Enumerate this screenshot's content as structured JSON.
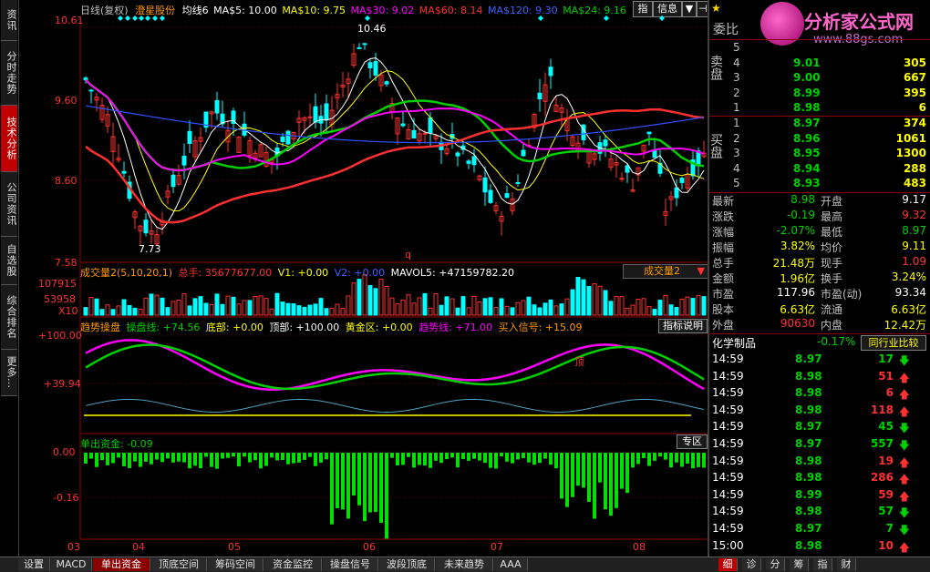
{
  "left_tabs": [
    {
      "label": "资讯",
      "active": false
    },
    {
      "label": "分时走势",
      "active": false
    },
    {
      "label": "技术分析",
      "active": true
    },
    {
      "label": "公司资讯",
      "active": false
    },
    {
      "label": "自选股",
      "active": false
    },
    {
      "label": "综合排名",
      "active": false
    },
    {
      "label": "更多…",
      "active": false
    }
  ],
  "main_header": {
    "period": "日线(复权)",
    "stock_name": "澄星股份",
    "ma_label": "均线6",
    "ma5": "MA$5: 10.00",
    "ma10": "MA$10: 9.75",
    "ma30": "MA$30: 9.02",
    "ma60": "MA$60: 8.14",
    "ma120": "MA$120: 9.30",
    "ma24": "MA$24: 9.16"
  },
  "top_buttons": {
    "zhi": "指",
    "info": "信息",
    "dropdown": "▼",
    "pin": "⊣"
  },
  "price_axis": [
    "10.61",
    "9.60",
    "8.60",
    "7.58"
  ],
  "price_annotations": {
    "high": "10.46",
    "low": "7.73",
    "q_mark": "q"
  },
  "volume_header": {
    "title": "成交量2(5,10,20,1)",
    "total": "总手: 35677677.00",
    "v1": "V1: +0.00",
    "v2": "V2: +0.00",
    "mavol5": "MAVOL5: +47159782.20",
    "selector": "成交量2"
  },
  "volume_axis": [
    "107915",
    "53958",
    "X10"
  ],
  "trend_header": {
    "title": "趋势操盘",
    "line": "操盘线: +74.56",
    "bottom": "底部: +0.00",
    "top": "顶部: +100.00",
    "gold": "黄金区: +0.00",
    "trend": "趋势线: +71.00",
    "buy": "买入信号: +15.09",
    "help": "指标说明"
  },
  "trend_axis": [
    "+100.00",
    "+39.94"
  ],
  "trend_top_mark": "顶",
  "flow_header": {
    "title": "单出资金: -0.09",
    "zone_button": "专区"
  },
  "flow_axis": [
    "0.00",
    "-0.16"
  ],
  "date_axis": [
    "03",
    "04",
    "05",
    "06",
    "07",
    "08"
  ],
  "right_panel": {
    "weibi_label": "委比",
    "sell_label": "卖盘",
    "buy_label": "买盘",
    "sells": [
      {
        "lvl": "5",
        "price": "",
        "vol": ""
      },
      {
        "lvl": "4",
        "price": "9.01",
        "vol": "305"
      },
      {
        "lvl": "3",
        "price": "9.00",
        "vol": "667"
      },
      {
        "lvl": "2",
        "price": "8.99",
        "vol": "395"
      },
      {
        "lvl": "1",
        "price": "8.98",
        "vol": "6"
      }
    ],
    "buys": [
      {
        "lvl": "1",
        "price": "8.97",
        "vol": "374"
      },
      {
        "lvl": "2",
        "price": "8.96",
        "vol": "1061"
      },
      {
        "lvl": "3",
        "price": "8.95",
        "vol": "1300"
      },
      {
        "lvl": "4",
        "price": "8.94",
        "vol": "288"
      },
      {
        "lvl": "5",
        "price": "8.93",
        "vol": "483"
      }
    ],
    "stats": [
      {
        "l1": "最新",
        "v1": "8.98",
        "c1": "#00d000",
        "l2": "开盘",
        "v2": "9.17",
        "c2": "#ffffff"
      },
      {
        "l1": "涨跌",
        "v1": "-0.19",
        "c1": "#00d000",
        "l2": "最高",
        "v2": "9.32",
        "c2": "#ff3030"
      },
      {
        "l1": "涨幅",
        "v1": "-2.07%",
        "c1": "#00d000",
        "l2": "最低",
        "v2": "8.97",
        "c2": "#00d000"
      },
      {
        "l1": "振幅",
        "v1": "3.82%",
        "c1": "#ffff00",
        "l2": "均价",
        "v2": "9.11",
        "c2": "#ffff00"
      },
      {
        "l1": "总手",
        "v1": "21.48万",
        "c1": "#ffff00",
        "l2": "现手",
        "v2": "1.09",
        "c2": "#ff3030"
      },
      {
        "l1": "金额",
        "v1": "1.96亿",
        "c1": "#ffff00",
        "l2": "换手",
        "v2": "3.24%",
        "c2": "#ffff00"
      },
      {
        "l1": "市盈",
        "v1": "117.96",
        "c1": "#ffffff",
        "l2": "市盈(动)",
        "v2": "93.34",
        "c2": "#ffffff"
      },
      {
        "l1": "股本",
        "v1": "6.63亿",
        "c1": "#ffff00",
        "l2": "流通",
        "v2": "6.63亿",
        "c2": "#ffff00"
      },
      {
        "l1": "外盘",
        "v1": "90630",
        "c1": "#ff3030",
        "l2": "内盘",
        "v2": "12.42万",
        "c2": "#ffff00"
      }
    ],
    "industry": {
      "name": "化学制品",
      "change": "-0.17%",
      "button": "同行业比较"
    },
    "ticks": [
      {
        "time": "14:59",
        "price": "8.97",
        "pc": "#00d000",
        "vol": "17",
        "vc": "#00d000",
        "dir": "down"
      },
      {
        "time": "14:59",
        "price": "8.98",
        "pc": "#00d000",
        "vol": "51",
        "vc": "#ff3030",
        "dir": "up"
      },
      {
        "time": "14:59",
        "price": "8.98",
        "pc": "#00d000",
        "vol": "6",
        "vc": "#ff3030",
        "dir": "up"
      },
      {
        "time": "14:59",
        "price": "8.98",
        "pc": "#00d000",
        "vol": "118",
        "vc": "#ff3030",
        "dir": "up"
      },
      {
        "time": "14:59",
        "price": "8.97",
        "pc": "#00d000",
        "vol": "45",
        "vc": "#00d000",
        "dir": "down"
      },
      {
        "time": "14:59",
        "price": "8.97",
        "pc": "#00d000",
        "vol": "557",
        "vc": "#00d000",
        "dir": "down"
      },
      {
        "time": "14:59",
        "price": "8.98",
        "pc": "#00d000",
        "vol": "19",
        "vc": "#ff3030",
        "dir": "up"
      },
      {
        "time": "14:59",
        "price": "8.98",
        "pc": "#00d000",
        "vol": "286",
        "vc": "#ff3030",
        "dir": "up"
      },
      {
        "time": "14:59",
        "price": "8.99",
        "pc": "#00d000",
        "vol": "59",
        "vc": "#ff3030",
        "dir": "up"
      },
      {
        "time": "14:59",
        "price": "8.98",
        "pc": "#00d000",
        "vol": "57",
        "vc": "#00d000",
        "dir": "down"
      },
      {
        "time": "14:59",
        "price": "8.97",
        "pc": "#00d000",
        "vol": "7",
        "vc": "#00d000",
        "dir": "down"
      },
      {
        "time": "15:00",
        "price": "8.98",
        "pc": "#00d000",
        "vol": "10",
        "vc": "#ff3030",
        "dir": "up"
      }
    ]
  },
  "logo": {
    "name": "分析家公式网",
    "url": "www.88gs.com"
  },
  "bottom_tabs": [
    "设置",
    "MACD",
    "单出资金",
    "顶底空间",
    "筹码空间",
    "资金监控",
    "操盘信号",
    "波段顶底",
    "未来趋势",
    "AAA"
  ],
  "bottom_active": "单出资金",
  "right_bottom_tabs": [
    "细",
    "诊",
    "分",
    "筹",
    "指",
    "财"
  ],
  "right_bottom_active": "细",
  "colors": {
    "up": "#ff3030",
    "down": "#00d000",
    "axis": "#8b0000",
    "bg": "#000000"
  }
}
